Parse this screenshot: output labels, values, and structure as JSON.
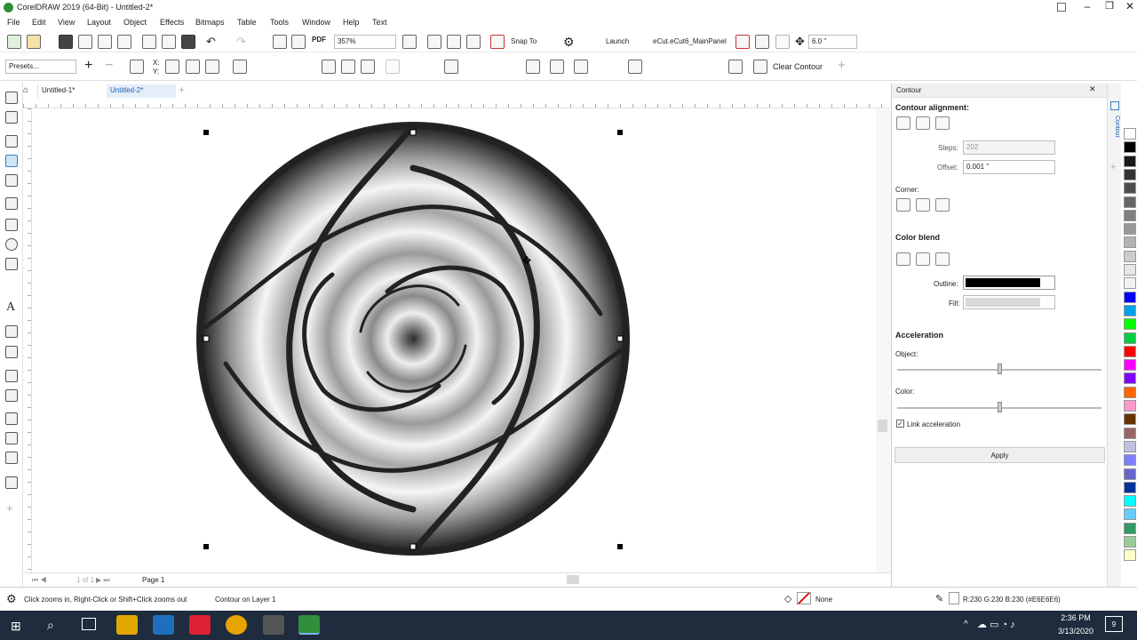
{
  "app": {
    "title": "CorelDRAW 2019 (64-Bit) - Untitled-2*"
  },
  "menu": [
    "File",
    "Edit",
    "View",
    "Layout",
    "Object",
    "Effects",
    "Bitmaps",
    "Table",
    "Tools",
    "Window",
    "Help",
    "Text"
  ],
  "toolbar": {
    "zoom": "357%",
    "snap_to": "Snap To",
    "launch": "Launch",
    "macro": "eCut.eCut6_MainPanel",
    "nudge": "6.0 \""
  },
  "propbar": {
    "presets": "Presets...",
    "clear_contour": "Clear Contour"
  },
  "doc_tabs": [
    "Untitled-1*",
    "Untitled-2*"
  ],
  "pagebar": {
    "page_of": "1 of 1",
    "page_tab": "Page 1"
  },
  "docker": {
    "title": "Contour",
    "side_tab": "Contour",
    "alignment_label": "Contour alignment:",
    "steps_label": "Steps:",
    "steps_value": "202",
    "offset_label": "Offset:",
    "offset_value": "0.001 \"",
    "corner_label": "Corner:",
    "color_blend_label": "Color blend",
    "outline_label": "Outline:",
    "fill_label": "Fill:",
    "acceleration_label": "Acceleration",
    "object_label": "Object:",
    "color_label": "Color:",
    "link_accel_label": "Link acceleration",
    "apply_label": "Apply",
    "outline_color": "#000000",
    "fill_color": "#d8d8d8"
  },
  "status": {
    "hint": "Click zooms in, Right-Click or Shift+Click zooms out",
    "object": "Contour on Layer 1",
    "fill": "None",
    "color": "R:230 G:230 B:230 (#E6E6E6)"
  },
  "taskbar": {
    "time": "2:36 PM",
    "date": "3/13/2020",
    "notif": "9"
  },
  "palette": [
    "#ffffff",
    "#000000",
    "#1a1a1a",
    "#333333",
    "#4d4d4d",
    "#666666",
    "#808080",
    "#999999",
    "#b3b3b3",
    "#cccccc",
    "#e6e6e6",
    "#f2f2f2",
    "#0000ff",
    "#00a0e6",
    "#00ff00",
    "#00cc44",
    "#ff0000",
    "#ff00ff",
    "#7f00ff",
    "#ff6600",
    "#ff99cc",
    "#663300",
    "#996666",
    "#c0c0e0",
    "#8080ff",
    "#6666cc",
    "#003399",
    "#00ffff",
    "#66ccff",
    "#339966",
    "#99cc99",
    "#ffffcc"
  ]
}
